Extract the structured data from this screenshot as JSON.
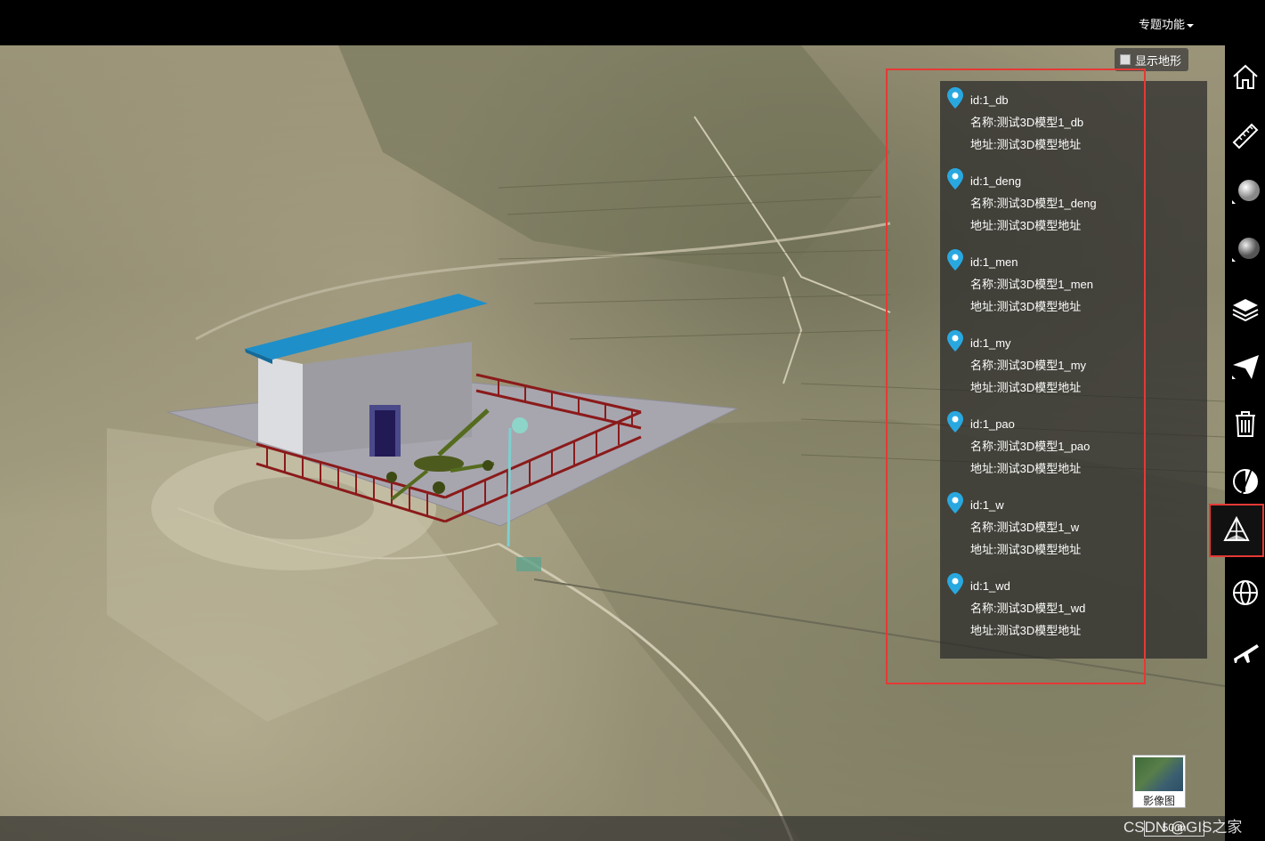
{
  "topbar": {
    "menu_label": "专题功能"
  },
  "terrain_toggle": {
    "label": "显示地形",
    "checked": false
  },
  "info_list": [
    {
      "id": "id:1_db",
      "name": "名称:测试3D模型1_db",
      "address": "地址:测试3D模型地址"
    },
    {
      "id": "id:1_deng",
      "name": "名称:测试3D模型1_deng",
      "address": "地址:测试3D模型地址"
    },
    {
      "id": "id:1_men",
      "name": "名称:测试3D模型1_men",
      "address": "地址:测试3D模型地址"
    },
    {
      "id": "id:1_my",
      "name": "名称:测试3D模型1_my",
      "address": "地址:测试3D模型地址"
    },
    {
      "id": "id:1_pao",
      "name": "名称:测试3D模型1_pao",
      "address": "地址:测试3D模型地址"
    },
    {
      "id": "id:1_w",
      "name": "名称:测试3D模型1_w",
      "address": "地址:测试3D模型地址"
    },
    {
      "id": "id:1_wd",
      "name": "名称:测试3D模型1_wd",
      "address": "地址:测试3D模型地址"
    }
  ],
  "toolbar": [
    {
      "icon": "home-icon"
    },
    {
      "icon": "ruler-icon"
    },
    {
      "icon": "sphere-icon"
    },
    {
      "icon": "sphere-dark-icon"
    },
    {
      "icon": "layers-icon"
    },
    {
      "icon": "paper-plane-icon"
    },
    {
      "icon": "trash-icon"
    },
    {
      "icon": "half-circle-icon"
    },
    {
      "icon": "pyramid-icon",
      "active": true
    },
    {
      "icon": "globe-icon"
    },
    {
      "icon": "airplane-icon"
    }
  ],
  "basemap": {
    "label": "影像图"
  },
  "scale": {
    "label": "50 m"
  },
  "watermark": "CSDN @GIS之家",
  "colors": {
    "highlight": "#e53935",
    "pin": "#29a8e0",
    "roof": "#1e8fc9",
    "fence": "#8b1a1a"
  }
}
